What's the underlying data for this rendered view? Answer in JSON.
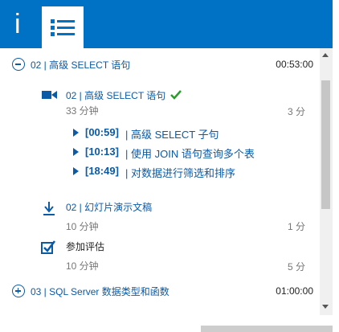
{
  "tabs": {
    "info_label": "i"
  },
  "modules": [
    {
      "title": "02 | 高级 SELECT 语句",
      "duration": "00:53:00"
    },
    {
      "title": "03 | SQL Server 数据类型和函数",
      "duration": "01:00:00"
    }
  ],
  "video": {
    "title": "02 | 高级 SELECT 语句",
    "length": "33 分钟",
    "points": "3 分"
  },
  "chapters": [
    {
      "time": "[00:59]",
      "label": "| 高级 SELECT 子句"
    },
    {
      "time": "[10:13]",
      "label": "| 使用 JOIN 语句查询多个表"
    },
    {
      "time": "[18:49]",
      "label": "| 对数据进行筛选和排序"
    }
  ],
  "slides": {
    "title": "02 | 幻灯片演示文稿",
    "length": "10 分钟",
    "points": "1 分"
  },
  "assessment": {
    "title": "参加评估",
    "length": "10 分钟",
    "points": "5 分"
  },
  "colors": {
    "accent": "#0072c6",
    "link": "#0b5aa6",
    "check": "#2e9a2e"
  }
}
